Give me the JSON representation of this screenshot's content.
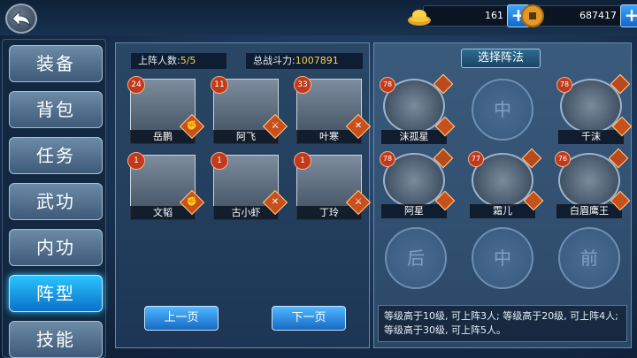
{
  "currency": {
    "gold": "161",
    "coins": "687417",
    "add_label": "+"
  },
  "sidebar": {
    "items": [
      {
        "label": "装备"
      },
      {
        "label": "背包"
      },
      {
        "label": "任务"
      },
      {
        "label": "武功"
      },
      {
        "label": "内功"
      },
      {
        "label": "阵型"
      },
      {
        "label": "技能"
      }
    ],
    "active": "阵型"
  },
  "roster": {
    "deploy_label": "上阵人数:",
    "deploy_value": "5/5",
    "power_label": "总战斗力:",
    "power_value": "1007891",
    "cards": [
      {
        "name": "岳鹏",
        "level": "24"
      },
      {
        "name": "阿飞",
        "level": "11"
      },
      {
        "name": "叶寒",
        "level": "33"
      },
      {
        "name": "文韬",
        "level": "1"
      },
      {
        "name": "古小虾",
        "level": "1"
      },
      {
        "name": "丁玲",
        "level": "1"
      }
    ],
    "prev_label": "上一页",
    "next_label": "下一页"
  },
  "formation": {
    "title": "选择阵法",
    "heroes": [
      {
        "name": "沫孤星",
        "level": "78"
      },
      {
        "name": "千沫",
        "level": "78"
      },
      {
        "name": "阿星",
        "level": "78"
      },
      {
        "name": "霜儿",
        "level": "77"
      },
      {
        "name": "白眉鹰王",
        "level": "76"
      }
    ],
    "slots": [
      "中",
      "后",
      "中",
      "前"
    ],
    "info_text": "等级高于10级, 可上阵3人; 等级高于20级, 可上阵4人; 等级高于30级, 可上阵5人。"
  },
  "colors": {
    "accent": "#2bc4ff",
    "level_badge": "#c23a1b",
    "power_value": "#f4d35e"
  },
  "icons": [
    "back-arrow-icon",
    "gold-ingot-icon",
    "coin-icon",
    "plus-icon",
    "sword-icon",
    "fist-icon"
  ]
}
